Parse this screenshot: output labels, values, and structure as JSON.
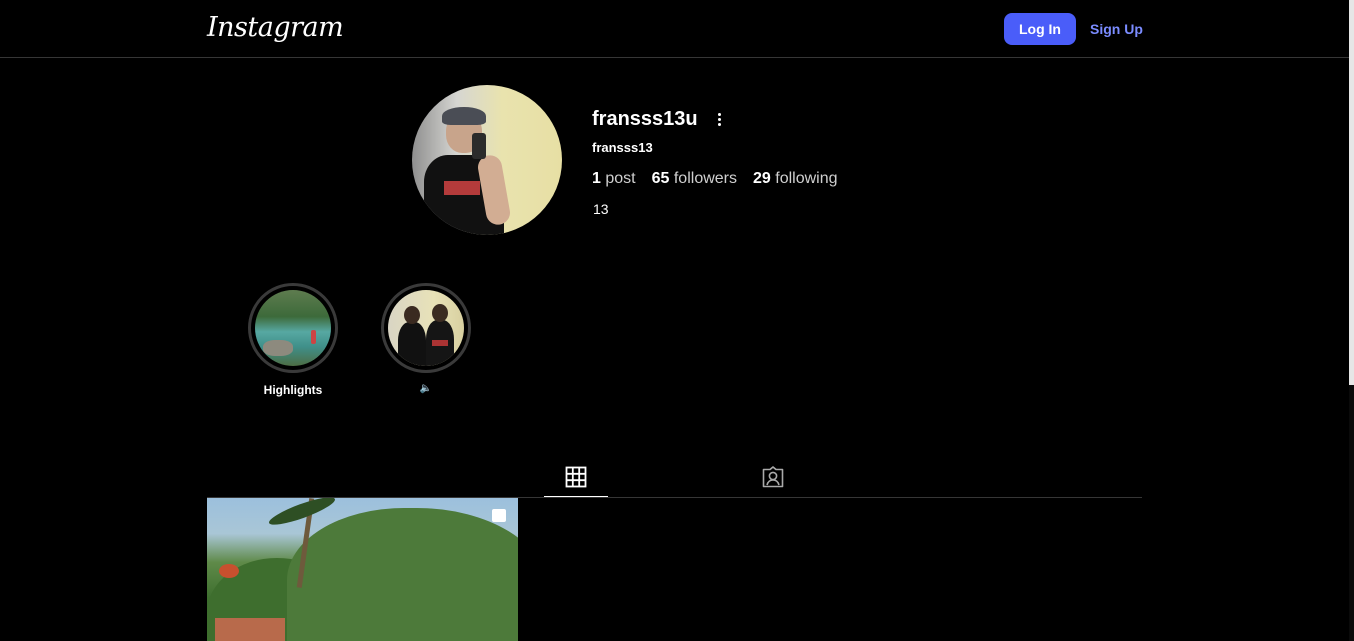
{
  "header": {
    "logo": "Instagram",
    "login_label": "Log In",
    "signup_label": "Sign Up"
  },
  "profile": {
    "username": "fransss13u",
    "full_name": "fransss13",
    "stats": {
      "posts_count": "1",
      "posts_label": "post",
      "followers_count": "65",
      "followers_label": "followers",
      "following_count": "29",
      "following_label": "following"
    },
    "bio": "13"
  },
  "highlights": [
    {
      "label": "Highlights"
    },
    {
      "label": "🔈"
    }
  ],
  "tabs": [
    {
      "icon": "grid-icon",
      "active": true
    },
    {
      "icon": "tagged-icon",
      "active": false
    }
  ],
  "posts": [
    {
      "icon": "multiple-photos-icon"
    }
  ],
  "colors": {
    "background": "#000000",
    "login_button": "#4a5df9",
    "signup_link": "#7b8cff",
    "divider": "#363636"
  }
}
